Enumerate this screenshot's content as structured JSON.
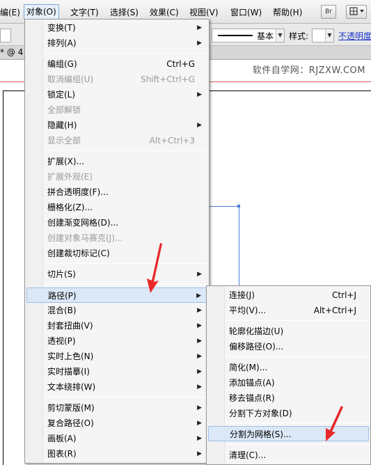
{
  "menubar": {
    "items": [
      "编(E)",
      "对象(O)",
      "文字(T)",
      "选择(S)",
      "效果(C)",
      "视图(V)",
      "窗口(W)",
      "帮助(H)"
    ],
    "br_label": "Br"
  },
  "controlbar": {
    "stroke_style": "基本",
    "style_label": "样式:",
    "opacity_link": "不透明度"
  },
  "doctab": {
    "label": "* @ 4"
  },
  "watermark": "软件自学网：RJZXW.COM",
  "object_menu": {
    "items": [
      {
        "label": "变换(T)",
        "shortcut": "",
        "submenu": true,
        "disabled": false
      },
      {
        "label": "排列(A)",
        "shortcut": "",
        "submenu": true,
        "disabled": false
      },
      {
        "label": "编组(G)",
        "shortcut": "Ctrl+G",
        "submenu": false,
        "disabled": false
      },
      {
        "label": "取消编组(U)",
        "shortcut": "Shift+Ctrl+G",
        "submenu": false,
        "disabled": true
      },
      {
        "label": "锁定(L)",
        "shortcut": "",
        "submenu": true,
        "disabled": false
      },
      {
        "label": "全部解锁",
        "shortcut": "",
        "submenu": false,
        "disabled": true
      },
      {
        "label": "隐藏(H)",
        "shortcut": "",
        "submenu": true,
        "disabled": false
      },
      {
        "label": "显示全部",
        "shortcut": "Alt+Ctrl+3",
        "submenu": false,
        "disabled": true
      },
      {
        "label": "扩展(X)...",
        "shortcut": "",
        "submenu": false,
        "disabled": false
      },
      {
        "label": "扩展外观(E)",
        "shortcut": "",
        "submenu": false,
        "disabled": true
      },
      {
        "label": "拼合透明度(F)...",
        "shortcut": "",
        "submenu": false,
        "disabled": false
      },
      {
        "label": "栅格化(Z)...",
        "shortcut": "",
        "submenu": false,
        "disabled": false
      },
      {
        "label": "创建渐变网格(D)...",
        "shortcut": "",
        "submenu": false,
        "disabled": false
      },
      {
        "label": "创建对象马赛克(J)...",
        "shortcut": "",
        "submenu": false,
        "disabled": true
      },
      {
        "label": "创建裁切标记(C)",
        "shortcut": "",
        "submenu": false,
        "disabled": false
      },
      {
        "label": "切片(S)",
        "shortcut": "",
        "submenu": true,
        "disabled": false
      },
      {
        "label": "路径(P)",
        "shortcut": "",
        "submenu": true,
        "disabled": false,
        "highlighted": true
      },
      {
        "label": "混合(B)",
        "shortcut": "",
        "submenu": true,
        "disabled": false
      },
      {
        "label": "封套扭曲(V)",
        "shortcut": "",
        "submenu": true,
        "disabled": false
      },
      {
        "label": "透视(P)",
        "shortcut": "",
        "submenu": true,
        "disabled": false
      },
      {
        "label": "实时上色(N)",
        "shortcut": "",
        "submenu": true,
        "disabled": false
      },
      {
        "label": "实时描摹(I)",
        "shortcut": "",
        "submenu": true,
        "disabled": false
      },
      {
        "label": "文本绕排(W)",
        "shortcut": "",
        "submenu": true,
        "disabled": false
      },
      {
        "label": "剪切蒙版(M)",
        "shortcut": "",
        "submenu": true,
        "disabled": false
      },
      {
        "label": "复合路径(O)",
        "shortcut": "",
        "submenu": true,
        "disabled": false
      },
      {
        "label": "画板(A)",
        "shortcut": "",
        "submenu": true,
        "disabled": false
      },
      {
        "label": "图表(R)",
        "shortcut": "",
        "submenu": true,
        "disabled": false
      }
    ]
  },
  "path_submenu": {
    "items": [
      {
        "label": "连接(J)",
        "shortcut": "Ctrl+J"
      },
      {
        "label": "平均(V)...",
        "shortcut": "Alt+Ctrl+J"
      },
      {
        "label": "轮廓化描边(U)",
        "shortcut": ""
      },
      {
        "label": "偏移路径(O)...",
        "shortcut": ""
      },
      {
        "label": "简化(M)...",
        "shortcut": ""
      },
      {
        "label": "添加锚点(A)",
        "shortcut": ""
      },
      {
        "label": "移去锚点(R)",
        "shortcut": ""
      },
      {
        "label": "分割下方对象(D)",
        "shortcut": ""
      },
      {
        "label": "分割为网格(S)...",
        "shortcut": "",
        "highlighted": true
      },
      {
        "label": "清理(C)...",
        "shortcut": ""
      }
    ]
  },
  "colors": {
    "accent": "#4b78d8",
    "highlight": "#dbe8f7",
    "arrow": "#e8282a"
  }
}
